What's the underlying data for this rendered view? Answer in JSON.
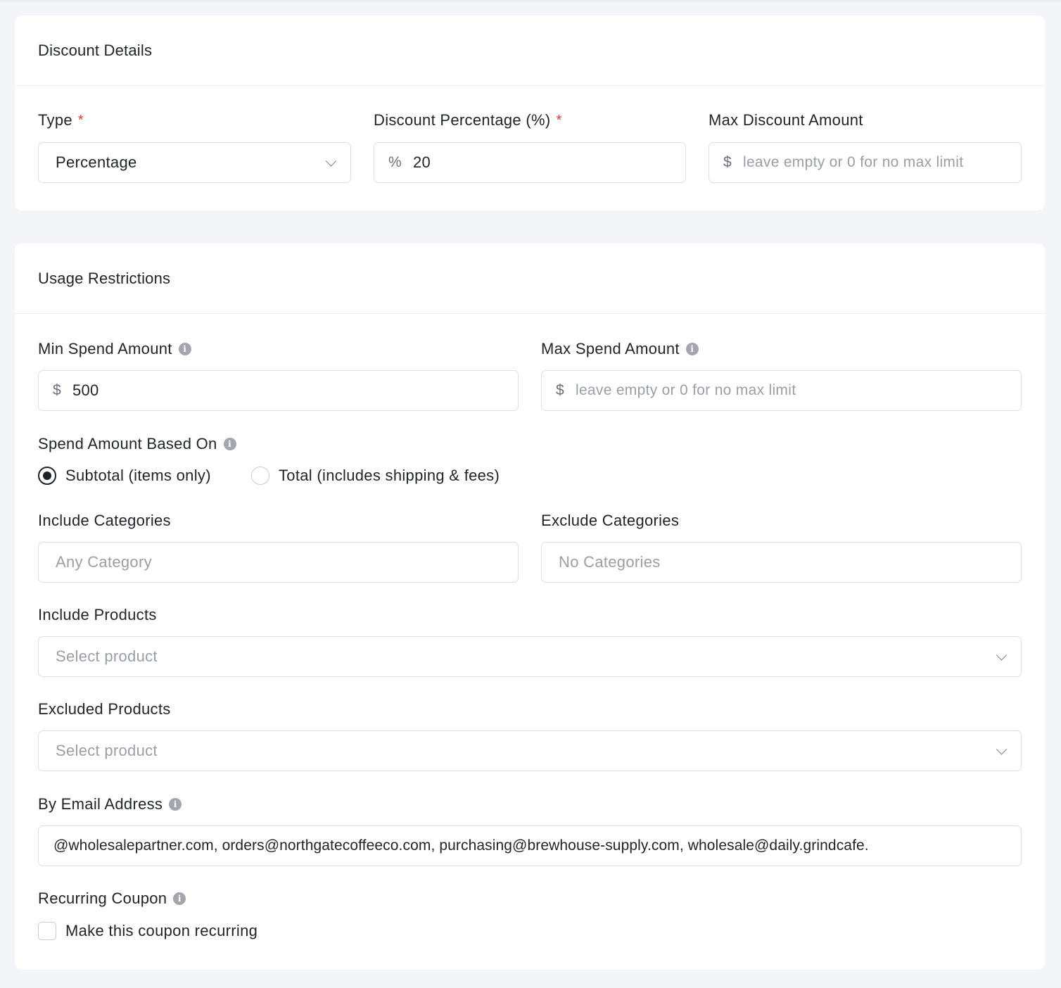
{
  "discount_details": {
    "title": "Discount Details",
    "type": {
      "label": "Type",
      "required_mark": "*",
      "value": "Percentage"
    },
    "percentage": {
      "label": "Discount Percentage (%)",
      "required_mark": "*",
      "prefix": "%",
      "value": "20"
    },
    "max_discount": {
      "label": "Max Discount Amount",
      "prefix": "$",
      "placeholder": "leave empty or 0 for no max limit"
    }
  },
  "usage_restrictions": {
    "title": "Usage Restrictions",
    "min_spend": {
      "label": "Min Spend Amount",
      "prefix": "$",
      "value": "500"
    },
    "max_spend": {
      "label": "Max Spend Amount",
      "prefix": "$",
      "placeholder": "leave empty or 0 for no max limit"
    },
    "spend_based_on": {
      "label": "Spend Amount Based On",
      "options": [
        {
          "label": "Subtotal (items only)",
          "selected": true
        },
        {
          "label": "Total (includes shipping & fees)",
          "selected": false
        }
      ]
    },
    "include_categories": {
      "label": "Include Categories",
      "placeholder": "Any Category"
    },
    "exclude_categories": {
      "label": "Exclude Categories",
      "placeholder": "No Categories"
    },
    "include_products": {
      "label": "Include Products",
      "placeholder": "Select product"
    },
    "excluded_products": {
      "label": "Excluded Products",
      "placeholder": "Select product"
    },
    "by_email": {
      "label": "By Email Address",
      "value": "@wholesalepartner.com, orders@northgatecoffeeco.com, purchasing@brewhouse-supply.com, wholesale@daily.grindcafe."
    },
    "recurring": {
      "label": "Recurring Coupon",
      "checkbox_label": "Make this coupon recurring",
      "checked": false
    }
  },
  "icons": {
    "info": "info-icon",
    "dropdown": "chevron-down-icon"
  },
  "colors": {
    "required": "#e03c3c",
    "text": "#1f2328",
    "placeholder": "#9a9ea6",
    "border": "#dcdfe4",
    "background": "#f4f5f8"
  }
}
